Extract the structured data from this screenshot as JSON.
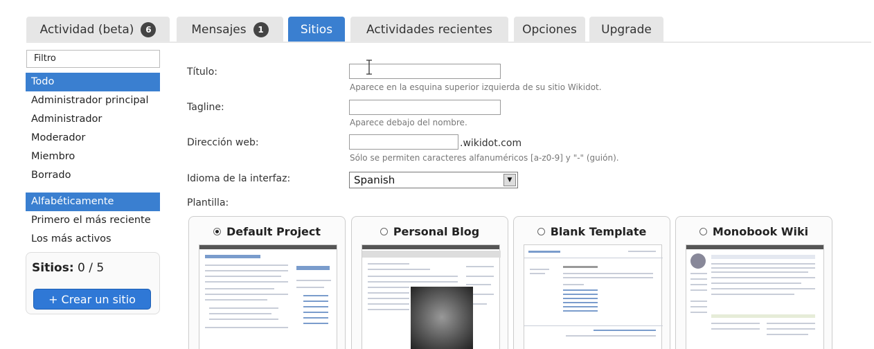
{
  "tabs": [
    {
      "label": "Actividad (beta)",
      "badge": "6"
    },
    {
      "label": "Mensajes",
      "badge": "1"
    },
    {
      "label": "Sitios",
      "badge": null
    },
    {
      "label": "Actividades recientes",
      "badge": null
    },
    {
      "label": "Opciones",
      "badge": null
    },
    {
      "label": "Upgrade",
      "badge": null
    }
  ],
  "sidebar": {
    "filter_label": "Filtro",
    "roles": [
      "Todo",
      "Administrador principal",
      "Administrador",
      "Moderador",
      "Miembro",
      "Borrado"
    ],
    "sort": [
      "Alfabéticamente",
      "Primero el más reciente",
      "Los más activos"
    ],
    "sites_label": "Sitios:",
    "sites_count": "0 / 5",
    "create_button": "+ Crear un sitio"
  },
  "form": {
    "title_label": "Título:",
    "title_hint": "Aparece en la esquina superior izquierda de su sitio Wikidot.",
    "tagline_label": "Tagline:",
    "tagline_hint": "Aparece debajo del nombre.",
    "web_label": "Dirección web:",
    "web_suffix": ".wikidot.com",
    "web_hint": "Sólo se permiten caracteres alfanuméricos [a-z0-9] y \"-\" (guión).",
    "lang_label": "Idioma de la interfaz:",
    "lang_value": "Spanish",
    "template_label": "Plantilla:"
  },
  "templates": [
    {
      "name": "Default Project",
      "selected": true
    },
    {
      "name": "Personal Blog",
      "selected": false
    },
    {
      "name": "Blank Template",
      "selected": false
    },
    {
      "name": "Monobook Wiki",
      "selected": false
    }
  ],
  "colors": {
    "accent": "#3a7fd0",
    "tab_bg": "#e6e6e6"
  }
}
